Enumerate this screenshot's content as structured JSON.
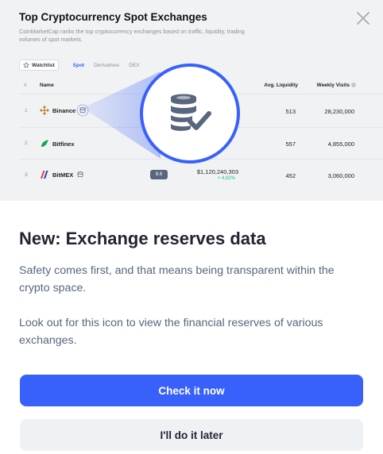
{
  "modal": {
    "hero": {
      "title": "Top Cryptocurrency Spot Exchanges",
      "subtitle": "CoinMarketCap ranks the top cryptocurrency exchanges based on traffic, liquidity, trading volumes of spot markets.",
      "close_icon": "close-icon",
      "filters": {
        "watchlist": "Watchlist",
        "tabs": [
          "Spot",
          "Derivatives",
          "DEX"
        ]
      },
      "table": {
        "headers": {
          "rank": "#",
          "name": "Name",
          "liquidity": "Avg. Liquidity",
          "visits": "Weekly Visits"
        },
        "rows": [
          {
            "rank": "1",
            "name": "Binance",
            "liquidity": "513",
            "visits": "28,230,000"
          },
          {
            "rank": "2",
            "name": "Bitfinex",
            "liquidity": "557",
            "visits": "4,855,000",
            "partial": "2"
          },
          {
            "rank": "3",
            "name": "BitMEX",
            "liquidity": "452",
            "visits": "3,060,000",
            "score": "8.6",
            "volume": "$1,120,240,303",
            "volume_change": "+ 4.82%"
          }
        ]
      },
      "spotlight_icon": "exchange-reserves-icon"
    },
    "heading": "New: Exchange reserves data",
    "paragraph_1": "Safety comes first, and that means being transparent within the crypto space.",
    "paragraph_2": "Look out for this icon to view the financial reserves of various exchanges.",
    "primary_button": "Check it now",
    "secondary_button": "I'll do it later",
    "colors": {
      "accent": "#3861fb",
      "heading": "#222531",
      "body": "#58667e",
      "secondary_button_bg": "#eff2f5",
      "positive": "#16c784"
    }
  }
}
